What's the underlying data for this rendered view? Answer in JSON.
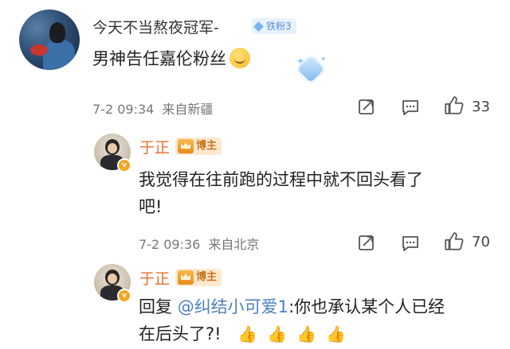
{
  "comment1": {
    "username": "今天不当熬夜冠军-",
    "fan_badge": "铁粉3",
    "text": "男神告任嘉伦粉丝",
    "date": "7-2 09:34",
    "location": "来自新疆",
    "likes": "33"
  },
  "reply1": {
    "username": "于正",
    "badge": "博主",
    "text_line1": "我觉得在往前跑的过程中就不回头看了",
    "text_line2": "吧!",
    "date": "7-2 09:36",
    "location": "来自北京",
    "likes": "70"
  },
  "reply2": {
    "username": "于正",
    "badge": "博主",
    "prefix": "回复 ",
    "mention": "@纠结小可爱1",
    "text_line1_rest": ":你也承认某个人已经",
    "text_line2": "在后头了?!"
  },
  "icons": [
    "share-icon",
    "comment-icon",
    "like-icon"
  ],
  "colors": {
    "mention": "#4d7fc2",
    "host_badge": "#e8702a",
    "fan_badge": "#5b8fd6"
  }
}
